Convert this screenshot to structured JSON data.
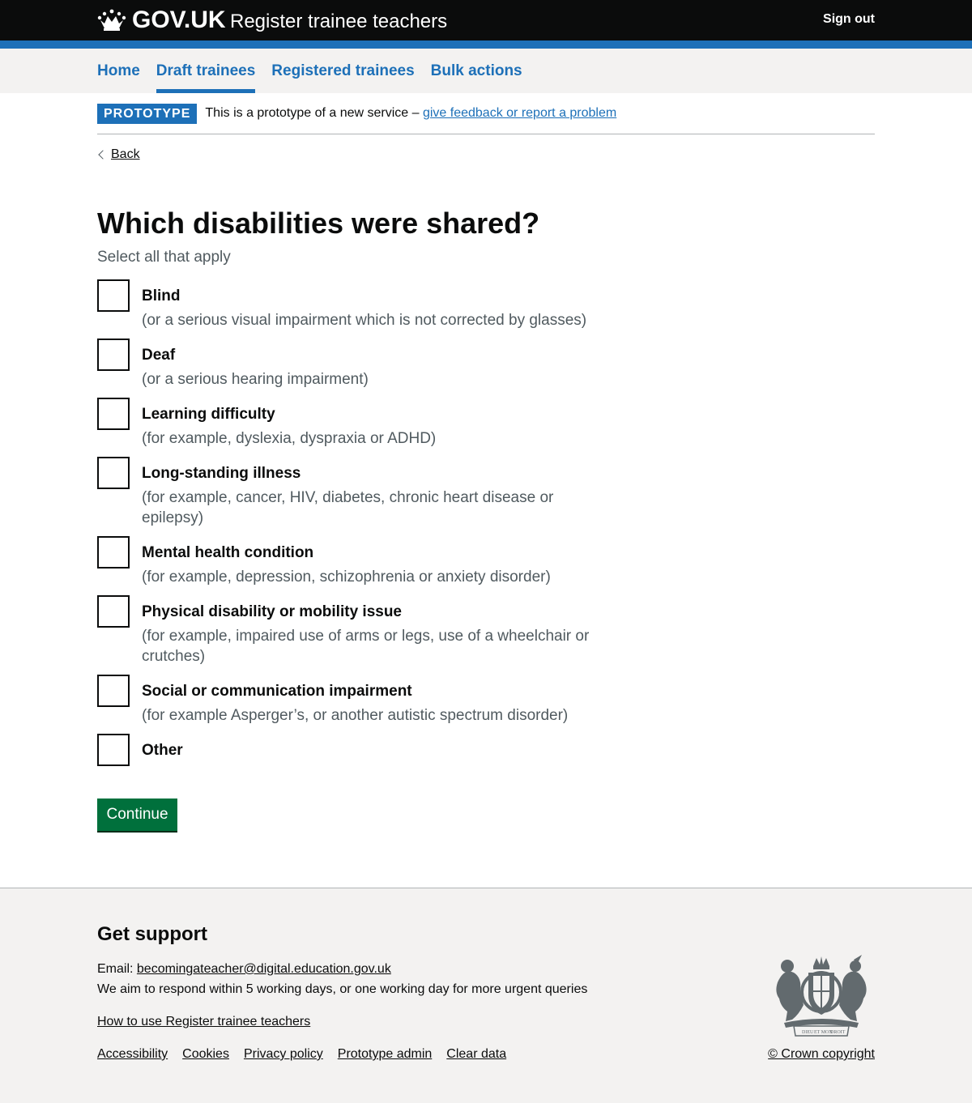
{
  "header": {
    "logo": "GOV.UK",
    "service_name": "Register trainee teachers",
    "sign_out": "Sign out",
    "colors": {
      "background": "#0b0c0c",
      "accent": "#1d70b8"
    }
  },
  "nav": {
    "items": [
      {
        "label": "Home"
      },
      {
        "label": "Draft trainees",
        "active": true
      },
      {
        "label": "Registered trainees"
      },
      {
        "label": "Bulk actions"
      }
    ]
  },
  "phase_banner": {
    "tag": "PROTOTYPE",
    "text": "This is a prototype of a new service –",
    "link": "give feedback or report a problem"
  },
  "back_link": "Back",
  "form": {
    "title": "Which disabilities were shared?",
    "hint": "Select all that apply",
    "options": [
      {
        "label": "Blind",
        "hint": "(or a serious visual impairment which is not corrected by glasses)",
        "checked": false
      },
      {
        "label": "Deaf",
        "hint": "(or a serious hearing impairment)",
        "checked": false
      },
      {
        "label": "Learning difficulty",
        "hint": "(for example, dyslexia, dyspraxia or ADHD)",
        "checked": false
      },
      {
        "label": "Long-standing illness",
        "hint": "(for example, cancer, HIV, diabetes, chronic heart disease or epilepsy)",
        "checked": false
      },
      {
        "label": "Mental health condition",
        "hint": "(for example, depression, schizophrenia or anxiety disorder)",
        "checked": false
      },
      {
        "label": "Physical disability or mobility issue",
        "hint": "(for example, impaired use of arms or legs, use of a wheelchair or crutches)",
        "checked": false
      },
      {
        "label": "Social or communication impairment",
        "hint": "(for example Asperger’s, or another autistic spectrum disorder)",
        "checked": false
      },
      {
        "label": "Other",
        "hint": "",
        "checked": false
      }
    ],
    "continue_label": "Continue",
    "continue_color": "#00703c"
  },
  "footer": {
    "title": "Get support",
    "email_label": "Email:",
    "email": "becomingateacher@digital.education.gov.uk",
    "respond_text": "We aim to respond within 5 working days, or one working day for more urgent queries",
    "how_to": "How to use Register trainee teachers",
    "links": [
      "Accessibility",
      "Cookies",
      "Privacy policy",
      "Prototype admin",
      "Clear data"
    ],
    "copyright": "© Crown copyright",
    "crest_text": {
      "motto_top": "DIEU",
      "motto_mid": "ET MON",
      "motto_right": "DROIT"
    }
  }
}
